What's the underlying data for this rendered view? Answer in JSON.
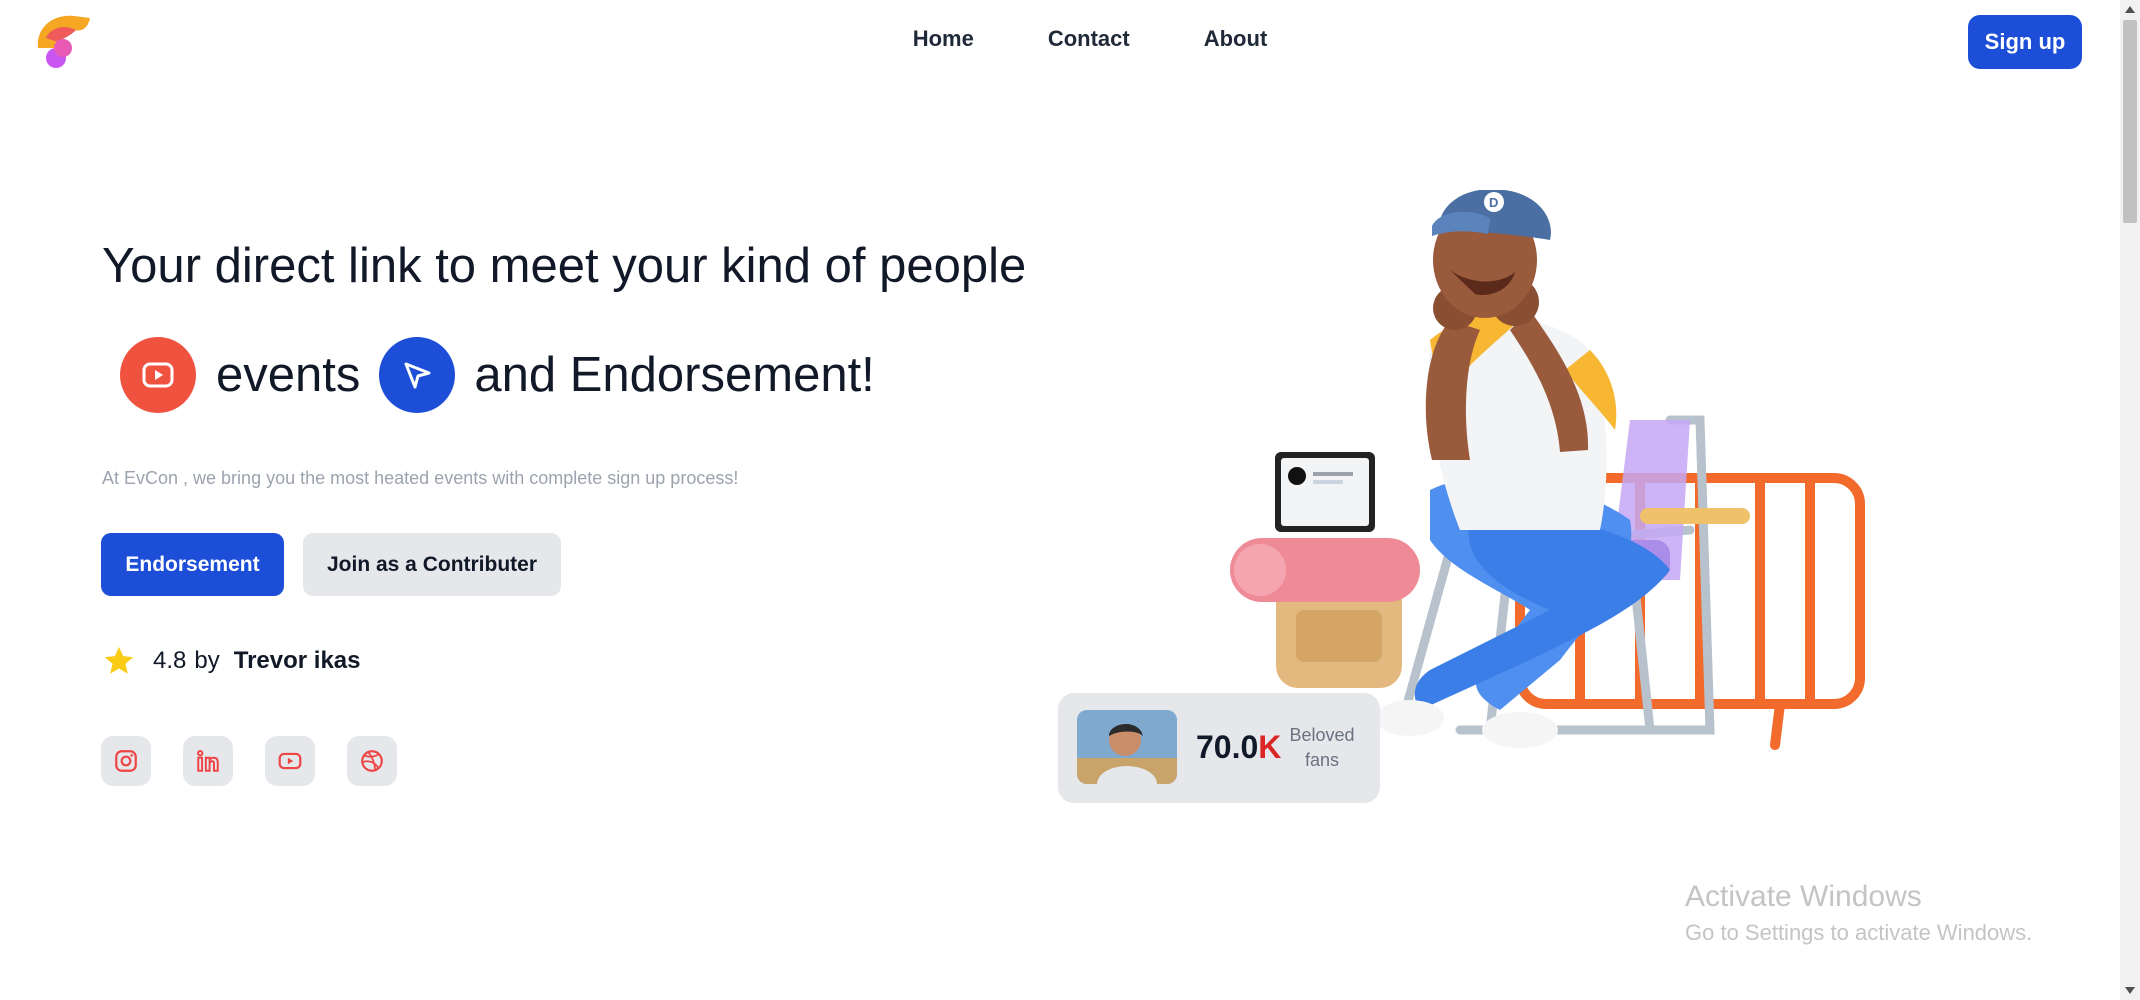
{
  "nav": {
    "logo": "brand-logo",
    "links": [
      "Home",
      "Contact",
      "About"
    ],
    "signup_label": "Sign up"
  },
  "hero": {
    "headline": "Your direct link to meet your kind of people",
    "word1": "events",
    "word2": "and Endorsement!",
    "subtext": "At EvCon , we bring you the most heated events with complete sign up process!",
    "primary_button": "Endorsement",
    "secondary_button": "Join as a Contributer",
    "rating_value": "4.8",
    "rating_by": "by",
    "rating_author": "Trevor ikas",
    "icons": [
      "youtube-play-icon",
      "cursor-arrow-icon",
      "star-icon"
    ]
  },
  "socials": [
    "instagram-icon",
    "linkedin-icon",
    "youtube-icon",
    "dribbble-icon"
  ],
  "fans_card": {
    "count_number": "70.0",
    "count_suffix": "K",
    "label_line1": "Beloved",
    "label_line2": "fans"
  },
  "watermark": {
    "title": "Activate Windows",
    "subtitle": "Go to Settings to activate Windows."
  },
  "colors": {
    "primary": "#1d4ed8",
    "accent_red": "#ef5340",
    "light_gray": "#e5e7eb"
  }
}
